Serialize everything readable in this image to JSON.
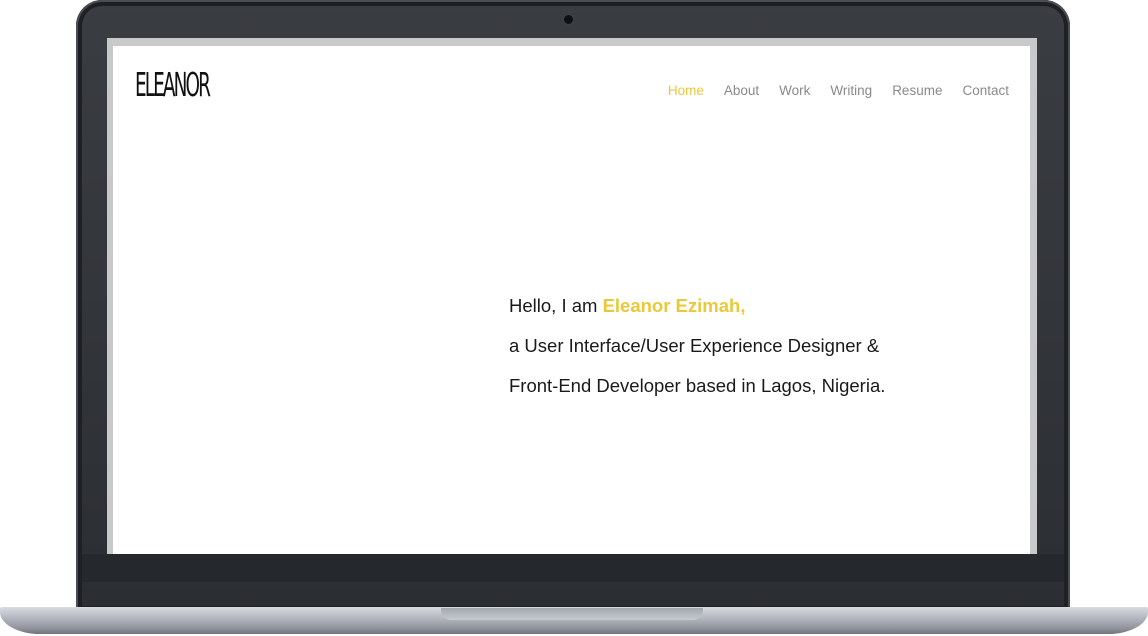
{
  "site": {
    "logo_text": "ELEANOR",
    "nav": [
      {
        "label": "Home",
        "active": true
      },
      {
        "label": "About",
        "active": false
      },
      {
        "label": "Work",
        "active": false
      },
      {
        "label": "Writing",
        "active": false
      },
      {
        "label": "Resume",
        "active": false
      },
      {
        "label": "Contact",
        "active": false
      }
    ],
    "hero": {
      "greeting": "Hello, I am ",
      "name": "Eleanor Ezimah,",
      "line2": "a User Interface/User Experience Designer &",
      "line3": "Front-End Developer based in Lagos, Nigeria."
    }
  },
  "colors": {
    "accent": "#e9c93a",
    "nav_text": "#8a8a8a",
    "body_text": "#1a1a1a",
    "bezel": "#2b2e33"
  },
  "icons": {
    "camera": "webcam-icon"
  }
}
